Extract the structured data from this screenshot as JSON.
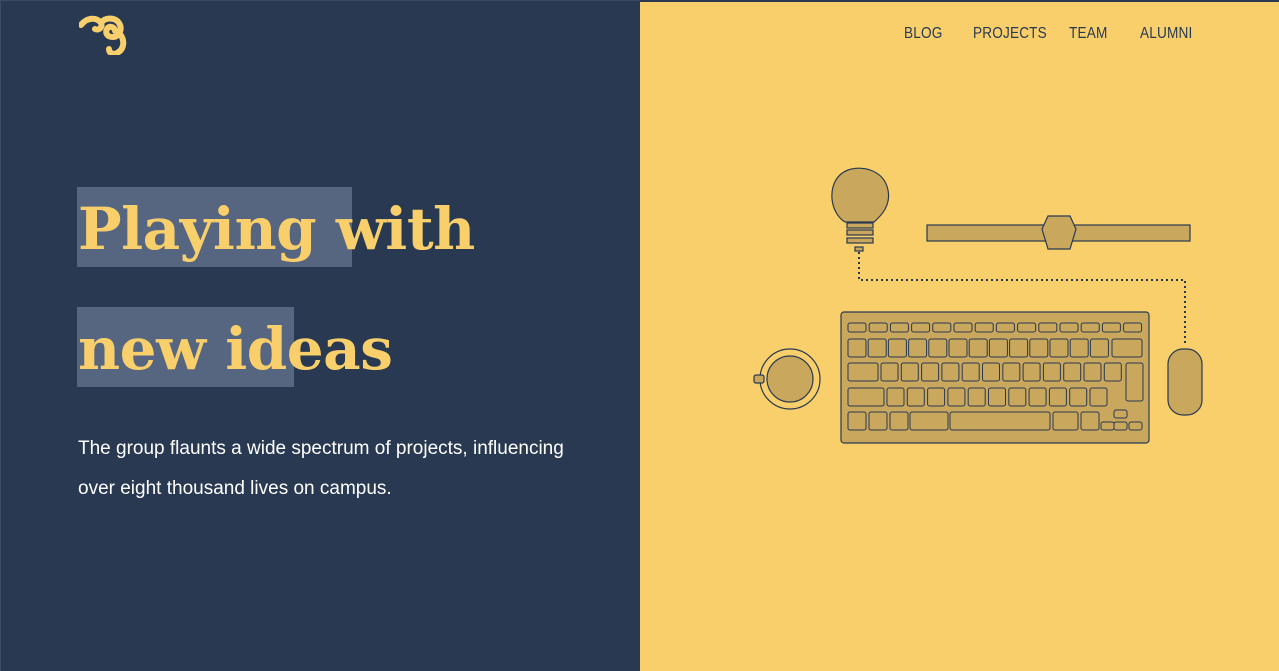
{
  "hero": {
    "line1": "Playing with",
    "line2": "new ideas",
    "description": "The group flaunts a wide spectrum of projects, influencing over eight thousand lives on campus."
  },
  "nav": {
    "items": [
      "BLOG",
      "PROJECTS",
      "TEAM",
      "ALUMNI"
    ]
  },
  "colors": {
    "navy": "#293952",
    "yellow": "#f8cf6b",
    "highlight": "#566580",
    "illustration_fill": "#c9a75c"
  },
  "icons": {
    "logo": "logo-icon",
    "illustration": "desk-illustration"
  }
}
